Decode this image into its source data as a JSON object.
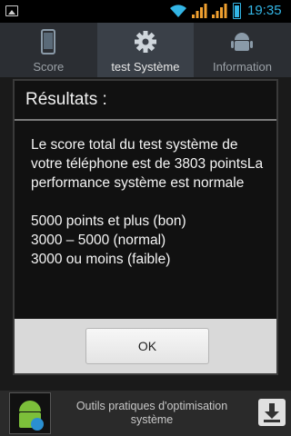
{
  "statusbar": {
    "time": "19:35",
    "icons": [
      "picture-icon",
      "wifi-icon",
      "signal-icon",
      "battery-icon"
    ],
    "accent": "#33b5e5"
  },
  "tabs": [
    {
      "label": "Score",
      "icon": "phone-icon",
      "active": false
    },
    {
      "label": "test Système",
      "icon": "gear-icon",
      "active": true
    },
    {
      "label": "Information",
      "icon": "android-icon",
      "active": false
    }
  ],
  "dialog": {
    "title": "Résultats :",
    "body": [
      "Le score total du test système de votre téléphone est de 3803 pointsLa performance système est normale",
      "5000 points et plus (bon)",
      "3000 – 5000 (normal)",
      "3000 ou moins (faible)"
    ],
    "ok_label": "OK"
  },
  "bottom": {
    "text": "Outils pratiques d'optimisation système",
    "app_icon": "android-app-icon",
    "download_icon": "download-icon"
  }
}
